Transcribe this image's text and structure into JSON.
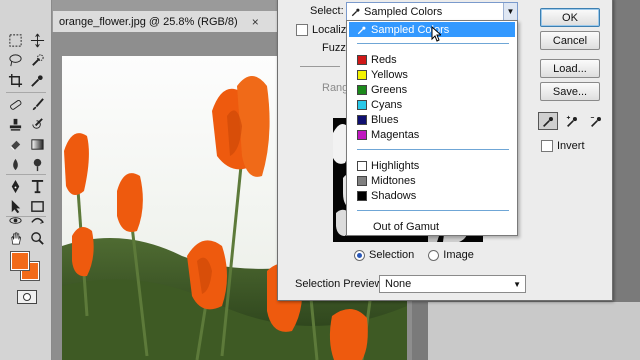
{
  "document": {
    "title": "orange_flower.jpg @ 25.8% (RGB/8)",
    "close_glyph": "×"
  },
  "toolbox": {
    "tools": [
      "marquee-tool-icon",
      "move-tool-icon",
      "lasso-tool-icon",
      "quick-select-tool-icon",
      "crop-tool-icon",
      "eyedropper-tool-icon",
      "healing-tool-icon",
      "brush-tool-icon",
      "stamp-tool-icon",
      "history-brush-tool-icon",
      "eraser-tool-icon",
      "gradient-tool-icon",
      "blur-tool-icon",
      "dodge-tool-icon",
      "pen-tool-icon",
      "type-tool-icon",
      "path-select-tool-icon",
      "shape-tool-icon",
      "3d-rotate-tool-icon",
      "3d-orbit-tool-icon",
      "hand-tool-icon",
      "zoom-tool-icon"
    ],
    "foreground_color": "#f26a18",
    "background_color": "#f26a18"
  },
  "dialog": {
    "select_label": "Select:",
    "select_value": "Sampled Colors",
    "localized_label": "Localized",
    "fuzziness_label": "Fuzzi",
    "range_label": "Rang",
    "radio_selection": "Selection",
    "radio_image": "Image",
    "selected_radio": "selection",
    "selection_preview_label": "Selection Preview:",
    "selection_preview_value": "None",
    "buttons": {
      "ok": "OK",
      "cancel": "Cancel",
      "load": "Load...",
      "save": "Save..."
    },
    "invert_label": "Invert"
  },
  "dropdown": {
    "items": [
      {
        "label": "Sampled Colors",
        "swatch": null,
        "selected": true
      },
      {
        "label": "Reds",
        "swatch": "#d01818"
      },
      {
        "label": "Yellows",
        "swatch": "#f2f200"
      },
      {
        "label": "Greens",
        "swatch": "#1c8a1c"
      },
      {
        "label": "Cyans",
        "swatch": "#28c8e8"
      },
      {
        "label": "Blues",
        "swatch": "#101070"
      },
      {
        "label": "Magentas",
        "swatch": "#c018c0"
      },
      {
        "label": "Highlights",
        "swatch": "#ffffff"
      },
      {
        "label": "Midtones",
        "swatch": "#808080"
      },
      {
        "label": "Shadows",
        "swatch": "#000000"
      },
      {
        "label": "Out of Gamut",
        "swatch": null
      }
    ]
  },
  "colors": {
    "accent_blue": "#3399ff",
    "flower_orange": "#ee5a0e"
  }
}
